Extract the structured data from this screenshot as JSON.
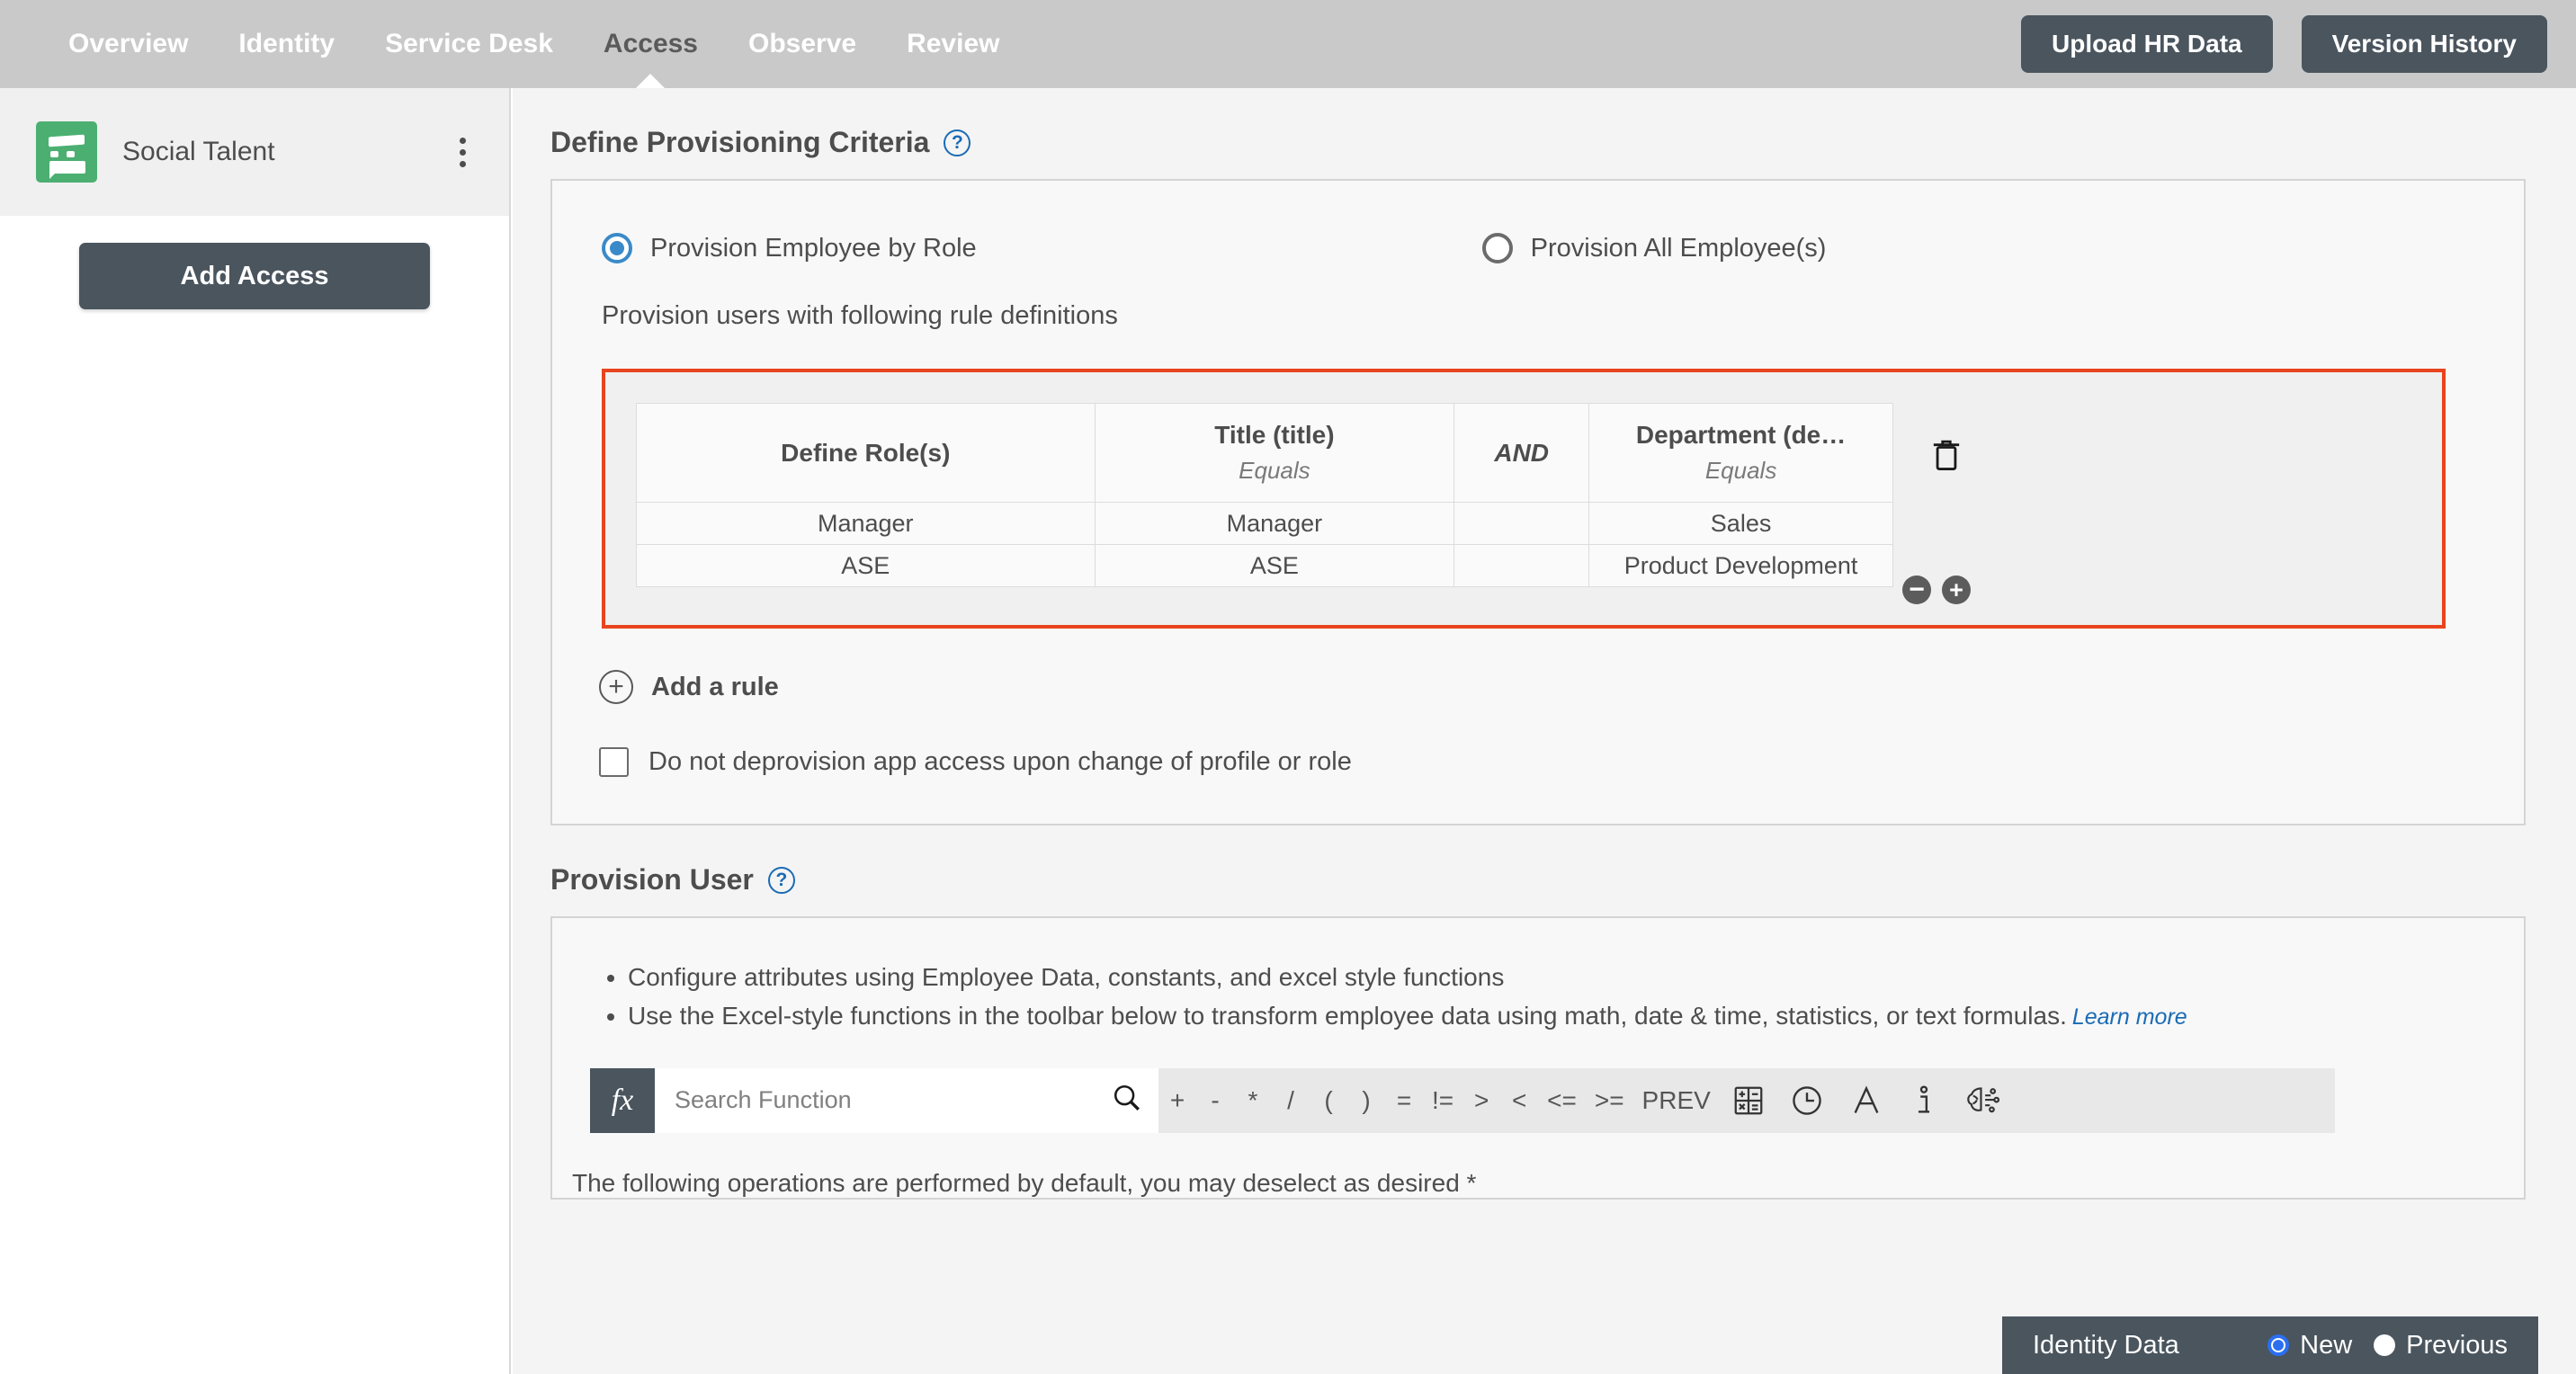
{
  "topnav": {
    "items": [
      {
        "label": "Overview",
        "active": false
      },
      {
        "label": "Identity",
        "active": false
      },
      {
        "label": "Service Desk",
        "active": false
      },
      {
        "label": "Access",
        "active": true
      },
      {
        "label": "Observe",
        "active": false
      },
      {
        "label": "Review",
        "active": false
      }
    ],
    "upload_button": "Upload HR Data",
    "version_button": "Version History"
  },
  "sidebar": {
    "app_name": "Social Talent",
    "menu_icon": "kebab-menu-icon",
    "add_access_button": "Add Access"
  },
  "provisioning": {
    "title": "Define Provisioning Criteria",
    "help_icon": "help-icon",
    "radio_by_role": "Provision Employee by Role",
    "radio_all_employees": "Provision All Employee(s)",
    "selected_radio": "Provision Employee by Role",
    "rule_intro": "Provision users with following rule definitions",
    "table": {
      "headers": {
        "role": "Define Role(s)",
        "title_attr": "Title (title)",
        "title_operator": "Equals",
        "conjunction": "AND",
        "department_attr": "Department (de…",
        "department_operator": "Equals"
      },
      "rows": [
        {
          "role": "Manager",
          "title": "Manager",
          "department": "Sales"
        },
        {
          "role": "ASE",
          "title": "ASE",
          "department": "Product Development"
        }
      ]
    },
    "delete_icon": "trash-icon",
    "remove_row_icon": "minus-circle-icon",
    "add_row_icon": "plus-circle-icon",
    "add_rule_label": "Add a rule",
    "add_rule_icon": "plus-circle-outline-icon",
    "deprovision_checkbox_label": "Do not deprovision app access upon change of profile or role",
    "deprovision_checked": false,
    "highlight_color": "#e8441d"
  },
  "provision_user": {
    "title": "Provision User",
    "help_icon": "help-icon",
    "bullets": [
      "Configure attributes using Employee Data, constants, and excel style functions",
      "Use the Excel-style functions in the toolbar below to transform employee data using math, date & time, statistics, or text formulas."
    ],
    "learn_more": "Learn more",
    "toolbar": {
      "fx_badge": "fx",
      "search_placeholder": "Search Function",
      "search_value": "",
      "search_icon": "search-icon",
      "operators": [
        "+",
        "-",
        "*",
        "/",
        "(",
        ")",
        "=",
        "!=",
        ">",
        "<",
        "<=",
        ">=",
        "PREV"
      ],
      "icons": [
        {
          "name": "math-functions-icon",
          "title": "Math"
        },
        {
          "name": "date-time-icon",
          "title": "Date & Time"
        },
        {
          "name": "text-functions-icon",
          "title": "Text"
        },
        {
          "name": "info-functions-icon",
          "title": "Info"
        },
        {
          "name": "ai-brain-icon",
          "title": "AI"
        }
      ]
    },
    "default_ops_note": "The following operations are performed by default, you may deselect as desired *"
  },
  "identity_data": {
    "label": "Identity Data",
    "options": [
      {
        "label": "New",
        "selected": true
      },
      {
        "label": "Previous",
        "selected": false
      }
    ],
    "accent_color": "#2b6ff0"
  }
}
